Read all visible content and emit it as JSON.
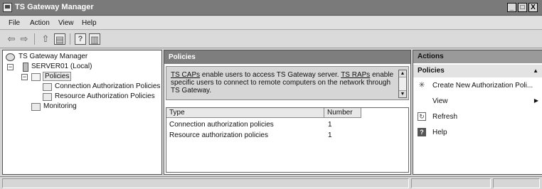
{
  "window": {
    "title": "TS Gateway Manager",
    "controls": {
      "minimize": "_",
      "maximize": "□",
      "close": "X"
    }
  },
  "menu": [
    "File",
    "Action",
    "View",
    "Help"
  ],
  "toolbar": {
    "buttons": [
      "back-icon",
      "forward-icon",
      "up-folder-icon",
      "show-hide-console-tree-icon",
      "help-icon",
      "show-action-pane-icon"
    ]
  },
  "tree": {
    "root": "TS Gateway Manager",
    "server": "SERVER01 (Local)",
    "policies": "Policies",
    "cap": "Connection Authorization Policies",
    "rap": "Resource Authorization Policies",
    "monitoring": "Monitoring"
  },
  "center": {
    "header": "Policies",
    "description": {
      "link1": "TS CAPs",
      "text1": " enable users to access TS Gateway server. ",
      "link2": "TS RAPs",
      "text2": " enable specific users to connect to remote computers on the network through TS Gateway."
    },
    "columns": [
      "Type",
      "Number"
    ],
    "rows": [
      {
        "type": "Connection authorization policies",
        "number": "1"
      },
      {
        "type": "Resource authorization policies",
        "number": "1"
      }
    ]
  },
  "actions": {
    "header": "Actions",
    "section": "Policies",
    "items": [
      {
        "label": "Create New Authorization Poli...",
        "icon": "sparkle-icon"
      },
      {
        "label": "View",
        "icon": "none"
      },
      {
        "label": "Refresh",
        "icon": "refresh-icon"
      },
      {
        "label": "Help",
        "icon": "help-icon"
      }
    ]
  }
}
